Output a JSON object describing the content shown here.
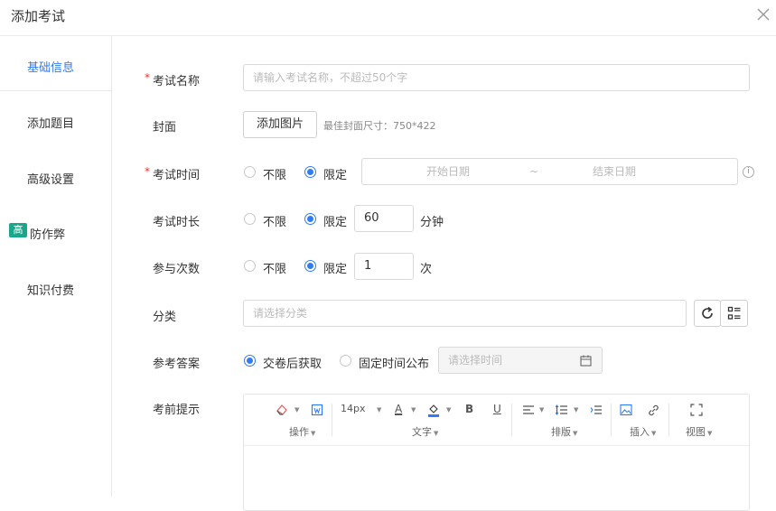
{
  "dialog": {
    "title": "添加考试"
  },
  "sidebar": {
    "items": [
      {
        "label": "基础信息"
      },
      {
        "label": "添加题目"
      },
      {
        "label": "高级设置"
      },
      {
        "label": "防作弊",
        "badge": "高"
      },
      {
        "label": "知识付费"
      }
    ]
  },
  "form": {
    "name": {
      "label": "考试名称",
      "placeholder": "请输入考试名称，不超过50个字"
    },
    "cover": {
      "label": "封面",
      "button": "添加图片",
      "hint": "最佳封面尺寸：750*422"
    },
    "time": {
      "label": "考试时间",
      "opt1": "不限",
      "opt2": "限定",
      "start": "开始日期",
      "sep": "~",
      "end": "结束日期"
    },
    "duration": {
      "label": "考试时长",
      "opt1": "不限",
      "opt2": "限定",
      "value": "60",
      "unit": "分钟"
    },
    "attempts": {
      "label": "参与次数",
      "opt1": "不限",
      "opt2": "限定",
      "value": "1",
      "unit": "次"
    },
    "category": {
      "label": "分类",
      "placeholder": "请选择分类"
    },
    "answer": {
      "label": "参考答案",
      "opt1": "交卷后获取",
      "opt2": "固定时间公布",
      "placeholder": "请选择时间"
    },
    "notice": {
      "label": "考前提示"
    }
  },
  "editor": {
    "groups": {
      "op": "操作",
      "text": "文字",
      "layout": "排版",
      "insert": "插入",
      "view": "视图"
    },
    "font_size": "14px",
    "text_color_glyph": "A",
    "bold": "B",
    "underline": "U"
  },
  "colors": {
    "accent": "#2f7cf6",
    "required": "#e33333",
    "badge": "#1aa68a"
  }
}
